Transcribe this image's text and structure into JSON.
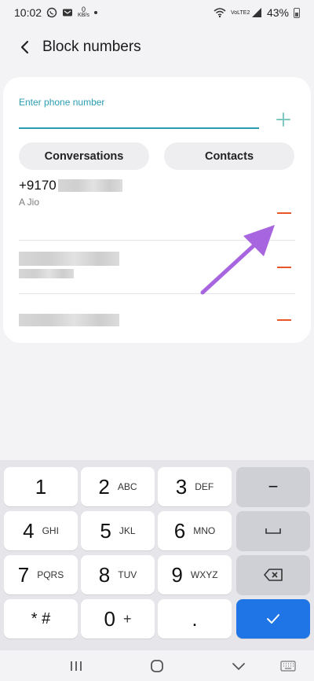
{
  "status_bar": {
    "time": "10:02",
    "data_speed_value": "0",
    "data_speed_unit": "KB/s",
    "network_label": "VoLTE2",
    "battery": "43%"
  },
  "app_bar": {
    "title": "Block numbers"
  },
  "phone_input": {
    "label": "Enter phone number",
    "value": ""
  },
  "buttons": {
    "conversations": "Conversations",
    "contacts": "Contacts"
  },
  "blocked_numbers": [
    {
      "number_prefix": "+9170",
      "carrier": "A Jio"
    },
    {
      "number_prefix": "",
      "carrier": ""
    },
    {
      "number_prefix": "",
      "carrier": ""
    }
  ],
  "keypad": {
    "rows": [
      [
        {
          "digit": "1",
          "letters": ""
        },
        {
          "digit": "2",
          "letters": "ABC"
        },
        {
          "digit": "3",
          "letters": "DEF"
        },
        {
          "digit": "−",
          "letters": ""
        }
      ],
      [
        {
          "digit": "4",
          "letters": "GHI"
        },
        {
          "digit": "5",
          "letters": "JKL"
        },
        {
          "digit": "6",
          "letters": "MNO"
        },
        {
          "digit": "space",
          "letters": ""
        }
      ],
      [
        {
          "digit": "7",
          "letters": "PQRS"
        },
        {
          "digit": "8",
          "letters": "TUV"
        },
        {
          "digit": "9",
          "letters": "WXYZ"
        },
        {
          "digit": "backspace",
          "letters": ""
        }
      ],
      [
        {
          "digit": "* #",
          "letters": ""
        },
        {
          "digit": "0",
          "letters": "+"
        },
        {
          "digit": ".",
          "letters": ""
        },
        {
          "digit": "done",
          "letters": ""
        }
      ]
    ]
  },
  "colors": {
    "accent": "#2a9db0",
    "remove": "#e8562a",
    "done_key": "#1f75e6",
    "arrow": "#a865e0"
  },
  "icons": {
    "back": "back-arrow-icon",
    "add": "plus-icon",
    "remove": "minus-icon",
    "recents": "recents-icon",
    "home": "home-icon",
    "back_nav": "chevron-down-icon",
    "keyboard": "keyboard-icon"
  }
}
